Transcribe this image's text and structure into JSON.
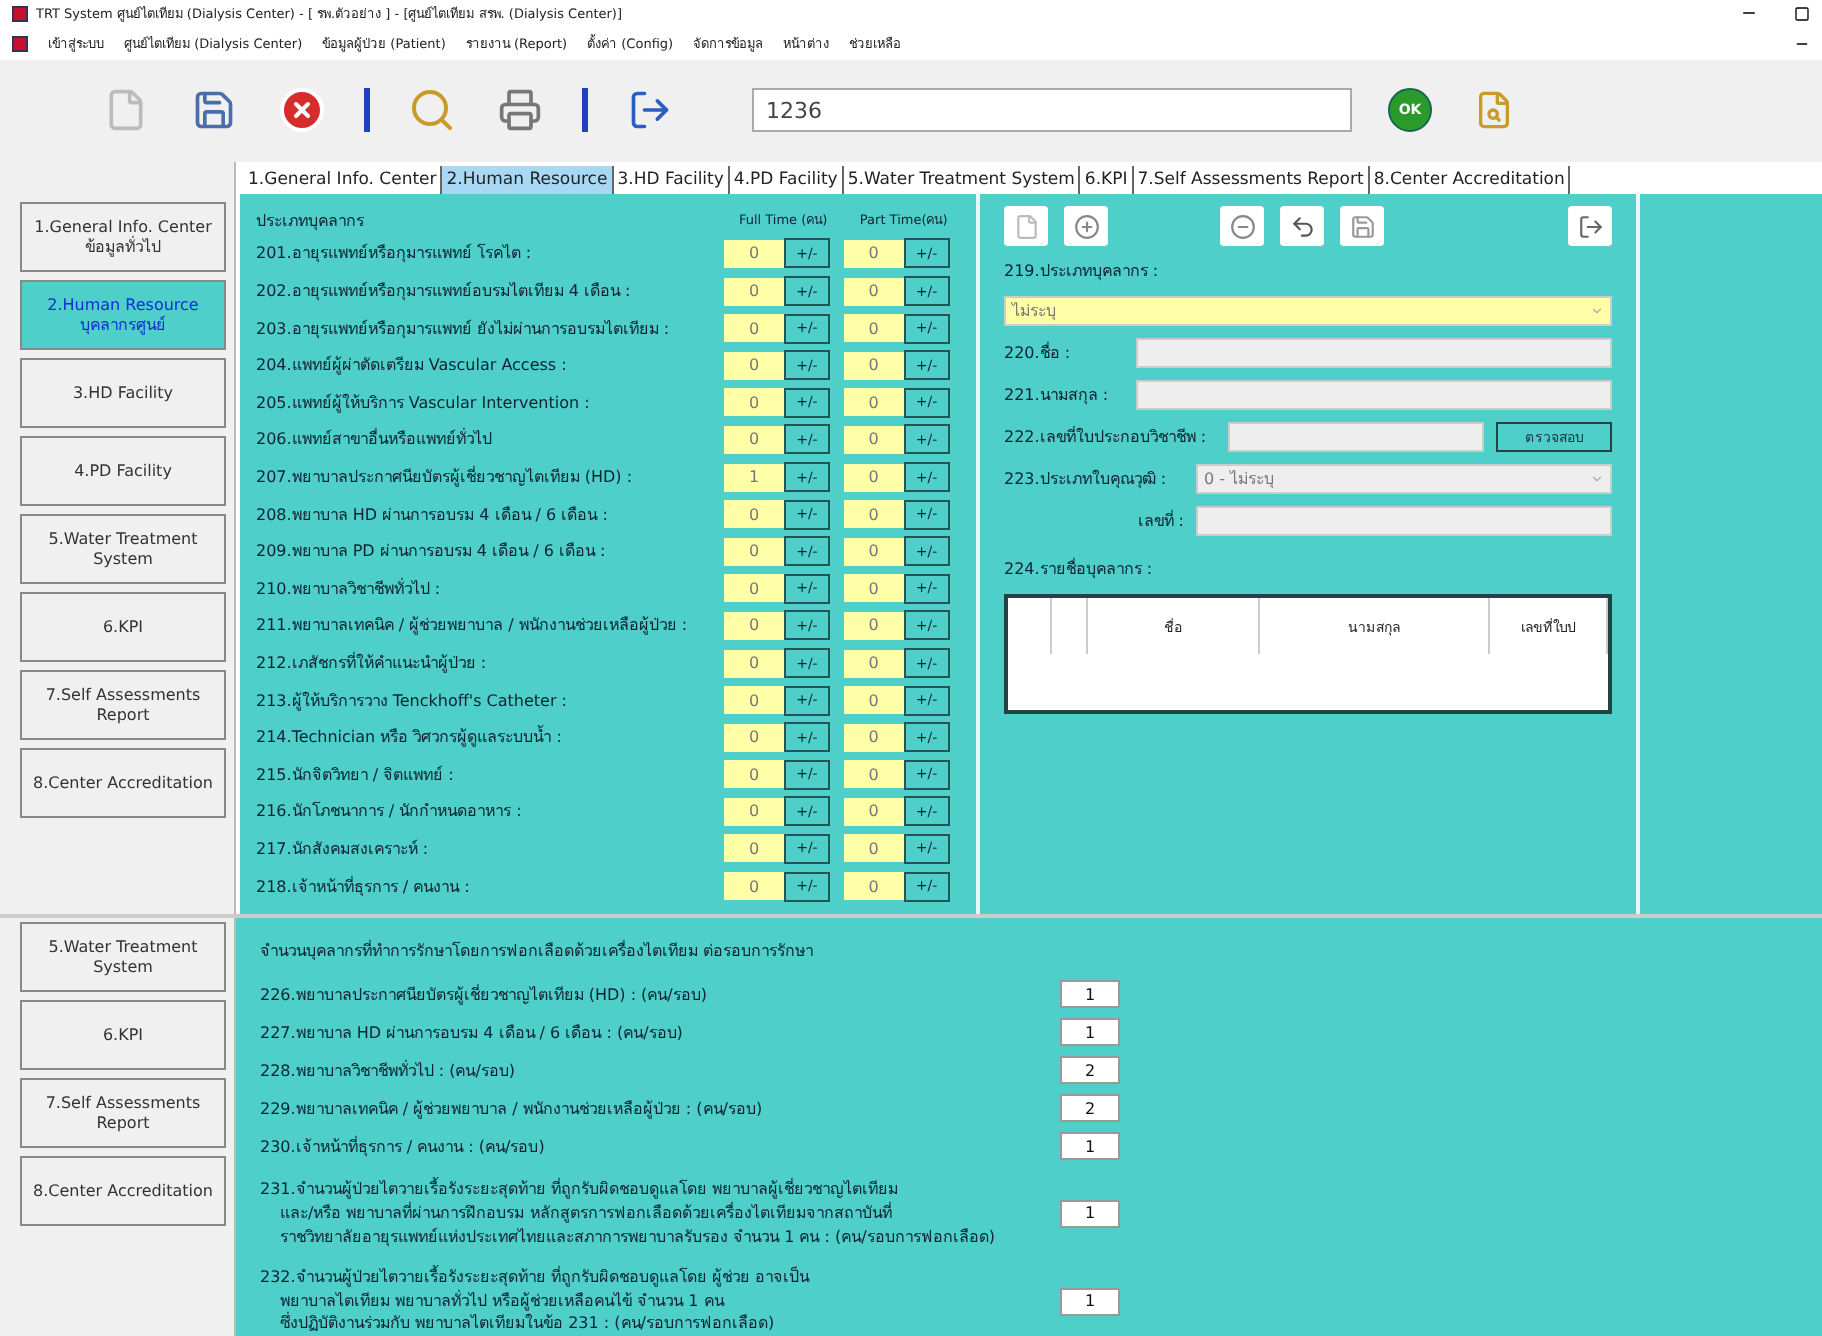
{
  "window": {
    "title": "TRT System ศูนย์ไตเทียม (Dialysis Center) - [ รพ.ตัวอย่าง ] - [ศูนย์ไตเทียม สรพ. (Dialysis Center)]"
  },
  "menu": [
    "เข้าสู่ระบบ",
    "ศูนย์ไตเทียม (Dialysis Center)",
    "ข้อมูลผู้ป่วย (Patient)",
    "รายงาน (Report)",
    "ตั้งค่า (Config)",
    "จัดการข้อมูล",
    "หน้าต่าง",
    "ช่วยเหลือ"
  ],
  "toolbar": {
    "search_value": "1236",
    "ok_label": "OK"
  },
  "tabs": [
    {
      "label": "1.General Info. Center",
      "selected": false
    },
    {
      "label": "2.Human Resource",
      "selected": true
    },
    {
      "label": "3.HD Facility",
      "selected": false
    },
    {
      "label": "4.PD Facility",
      "selected": false
    },
    {
      "label": "5.Water Treatment System",
      "selected": false
    },
    {
      "label": "6.KPI",
      "selected": false
    },
    {
      "label": "7.Self Assessments Report",
      "selected": false
    },
    {
      "label": "8.Center Accreditation",
      "selected": false
    }
  ],
  "sidebar": [
    {
      "label": "1.General Info. Center",
      "sub": "ข้อมูลทั่วไป",
      "selected": false
    },
    {
      "label": "2.Human Resource",
      "sub": "บุคลากรศูนย์",
      "selected": true
    },
    {
      "label": "3.HD Facility",
      "selected": false
    },
    {
      "label": "4.PD Facility",
      "selected": false
    },
    {
      "label": "5.Water Treatment System",
      "selected": false
    },
    {
      "label": "6.KPI",
      "selected": false
    },
    {
      "label": "7.Self Assessments Report",
      "selected": false
    },
    {
      "label": "8.Center Accreditation",
      "selected": false
    }
  ],
  "staff": {
    "heading": "ประเภทบุคลากร",
    "full_header": "Full Time (คน)",
    "part_header": "Part Time(คน)",
    "step_label": "+/-",
    "rows": [
      {
        "label": "201.อายุรแพทย์หรือกุมารแพทย์ โรคไต :",
        "full": "0",
        "part": "0"
      },
      {
        "label": "202.อายุรแพทย์หรือกุมารแพทย์อบรมไตเทียม 4 เดือน :",
        "full": "0",
        "part": "0"
      },
      {
        "label": "203.อายุรแพทย์หรือกุมารแพทย์ ยังไม่ผ่านการอบรมไตเทียม :",
        "full": "0",
        "part": "0"
      },
      {
        "label": "204.แพทย์ผู้ผ่าตัดเตรียม Vascular Access :",
        "full": "0",
        "part": "0"
      },
      {
        "label": "205.แพทย์ผู้ให้บริการ Vascular Intervention :",
        "full": "0",
        "part": "0"
      },
      {
        "label": "206.แพทย์สาขาอื่นหรือแพทย์ทั่วไป",
        "full": "0",
        "part": "0"
      },
      {
        "label": "207.พยาบาลประกาศนียบัตรผู้เชี่ยวชาญไตเทียม (HD) :",
        "full": "1",
        "part": "0"
      },
      {
        "label": "208.พยาบาล HD ผ่านการอบรม 4 เดือน / 6 เดือน :",
        "full": "0",
        "part": "0"
      },
      {
        "label": "209.พยาบาล PD ผ่านการอบรม 4 เดือน / 6 เดือน :",
        "full": "0",
        "part": "0"
      },
      {
        "label": "210.พยาบาลวิชาชีพทั่วไป :",
        "full": "0",
        "part": "0"
      },
      {
        "label": "211.พยาบาลเทคนิค / ผู้ช่วยพยาบาล / พนักงานช่วยเหลือผู้ป่วย :",
        "full": "0",
        "part": "0"
      },
      {
        "label": "212.เภสัชกรที่ให้คำแนะนำผู้ป่วย :",
        "full": "0",
        "part": "0"
      },
      {
        "label": "213.ผู้ให้บริการวาง Tenckhoff's Catheter :",
        "full": "0",
        "part": "0"
      },
      {
        "label": "214.Technician หรือ วิศวกรผู้ดูแลระบบน้ำ :",
        "full": "0",
        "part": "0"
      },
      {
        "label": "215.นักจิตวิทยา / จิตแพทย์ :",
        "full": "0",
        "part": "0"
      },
      {
        "label": "216.นักโภชนาการ / นักกำหนดอาหาร :",
        "full": "0",
        "part": "0"
      },
      {
        "label": "217.นักสังคมสงเคราะห์ :",
        "full": "0",
        "part": "0"
      },
      {
        "label": "218.เจ้าหน้าที่ธุรการ / คนงาน :",
        "full": "0",
        "part": "0"
      }
    ]
  },
  "person_form": {
    "type_label": "219.ประเภทบุคลากร :",
    "type_value": "ไม่ระบุ",
    "first_name_label": "220.ชื่อ :",
    "last_name_label": "221.นามสกุล :",
    "license_label": "222.เลขที่ใบประกอบวิชาชีพ :",
    "check_button": "ตรวจสอบ",
    "qualification_label": "223.ประเภทใบคุณวุฒิ :",
    "qualification_value": "0 - ไม่ระบุ",
    "number_label": "เลขที่ :",
    "list_label": "224.รายชื่อบุคลากร :",
    "columns": [
      "ชื่อ",
      "นามสกุล",
      "เลขที่ใบป"
    ]
  },
  "lower_window": {
    "sidebar": [
      {
        "label": "5.Water Treatment System",
        "selected": false
      },
      {
        "label": "6.KPI",
        "selected": false
      },
      {
        "label": "7.Self Assessments Report",
        "selected": false
      },
      {
        "label": "8.Center Accreditation",
        "selected": false
      }
    ],
    "heading": "จำนวนบุคลากรที่ทำการรักษาโดยการฟอกเลือดด้วยเครื่องไตเทียม ต่อรอบการรักษา",
    "rows": [
      {
        "lines": [
          "226.พยาบาลประกาศนียบัตรผู้เชี่ยวชาญไตเทียม (HD) : (คน/รอบ)"
        ],
        "value": "1"
      },
      {
        "lines": [
          "227.พยาบาล HD ผ่านการอบรม 4 เดือน / 6 เดือน : (คน/รอบ)"
        ],
        "value": "1"
      },
      {
        "lines": [
          "228.พยาบาลวิชาชีพทั่วไป : (คน/รอบ)"
        ],
        "value": "2"
      },
      {
        "lines": [
          "229.พยาบาลเทคนิค / ผู้ช่วยพยาบาล / พนักงานช่วยเหลือผู้ป่วย : (คน/รอบ)"
        ],
        "value": "2"
      },
      {
        "lines": [
          "230.เจ้าหน้าที่ธุรการ / คนงาน  : (คน/รอบ)"
        ],
        "value": "1"
      },
      {
        "lines": [
          "231.จำนวนผู้ป่วยไตวายเรื้อรังระยะสุดท้าย ที่ถูกรับผิดชอบดูแลโดย พยาบาลผู้เชี่ยวชาญไตเทียม",
          "และ/หรือ พยาบาลที่ผ่านการฝึกอบรม หลักสูตรการฟอกเลือดด้วยเครื่องไตเทียมจากสถาบันที่",
          "ราชวิทยาลัยอายุรแพทย์แห่งประเทศไทยและสภาการพยาบาลรับรอง จำนวน 1 คน : (คน/รอบการฟอกเลือด)"
        ],
        "value": "1"
      },
      {
        "lines": [
          "232.จำนวนผู้ป่วยไตวายเรื้อรังระยะสุดท้าย ที่ถูกรับผิดชอบดูแลโดย ผู้ช่วย อาจเป็น",
          "พยาบาลไตเทียม พยาบาลทั่วไป หรือผู้ช่วยเหลือคนไข้ จำนวน 1 คน",
          "ซึ่งปฏิบัติงานร่วมกับ พยาบาลไตเทียมในข้อ 231 : (คน/รอบการฟอกเลือด)"
        ],
        "value": "1"
      }
    ]
  }
}
